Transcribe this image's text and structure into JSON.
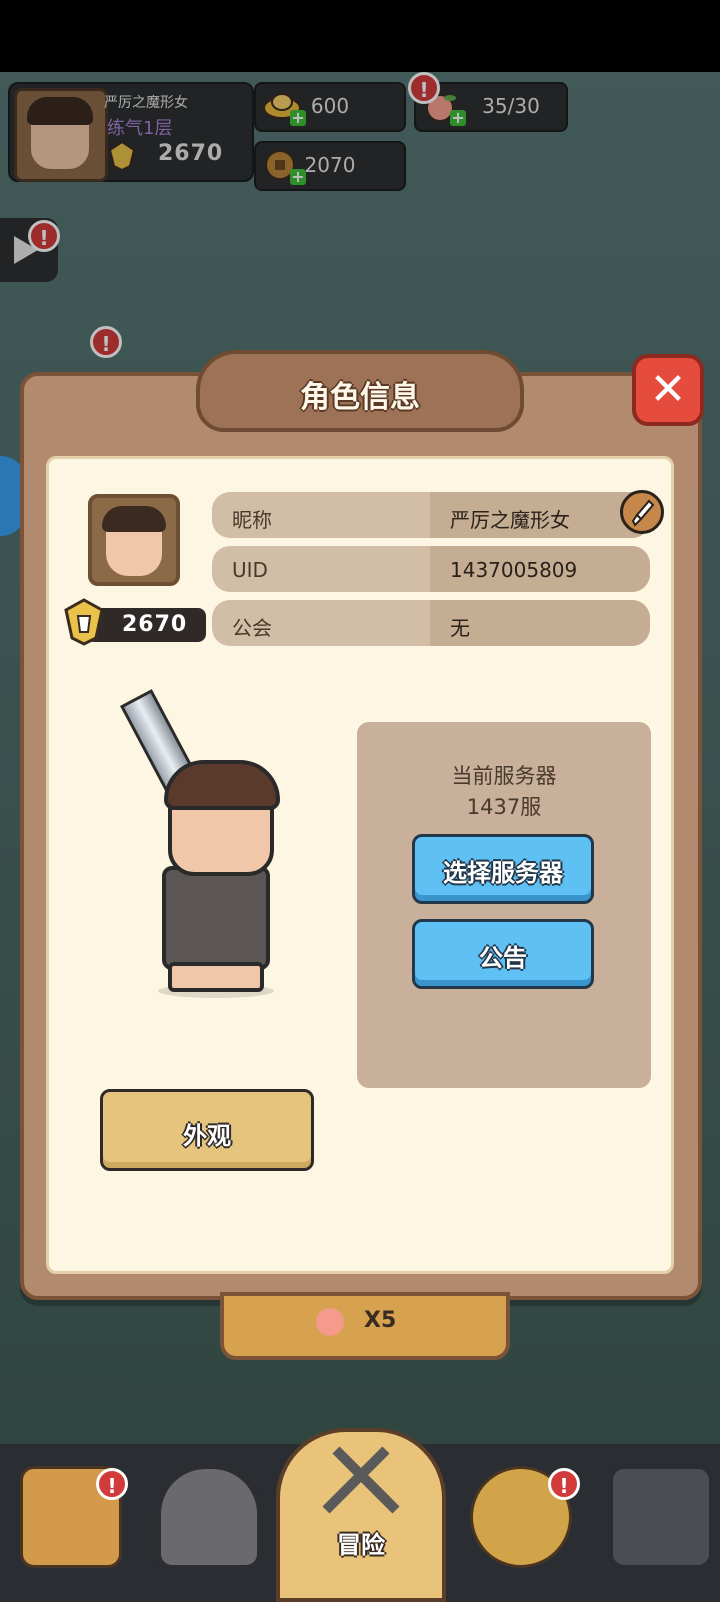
{
  "hud": {
    "player_name": "严厉之魔形女",
    "rank": "练气1层",
    "power": "2670",
    "gold": "600",
    "coins": "2070",
    "stamina": "35/30",
    "badge_mark": "!"
  },
  "modal": {
    "title": "角色信息",
    "close_symbol": "✕",
    "power": "2670",
    "rows": [
      {
        "label": "昵称",
        "value": "严厉之魔形女"
      },
      {
        "label": "UID",
        "value": "1437005809"
      },
      {
        "label": "公会",
        "value": "无"
      }
    ],
    "server": {
      "title": "当前服务器",
      "name": "1437服",
      "select_button": "选择服务器",
      "notice_button": "公告"
    },
    "appearance_button": "外观"
  },
  "reward": {
    "text": "X5"
  },
  "nav": {
    "center_label": "冒险"
  },
  "colors": {
    "modal_bg": "#b28a6d",
    "panel_bg": "#fdf6e3",
    "blue_button": "#5fc0f3",
    "yellow_button": "#e5c47d",
    "close_button": "#e64c3e",
    "badge": "#d23b3b"
  }
}
